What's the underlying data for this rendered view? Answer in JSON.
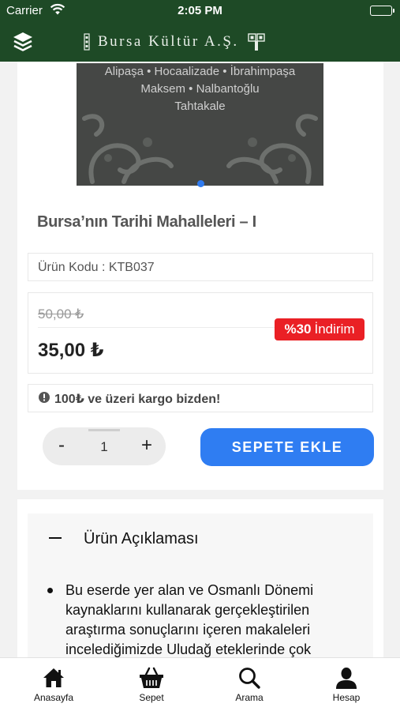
{
  "status_bar": {
    "carrier": "Carrier",
    "time": "2:05 PM"
  },
  "header": {
    "title": "Bursa Kültür A.Ş.",
    "menu_icon": "layers-icon"
  },
  "product": {
    "banner_lines": [
      "Alipaşa • Hocaalizade • İbrahimpaşa",
      "Maksem • Nalbantoğlu",
      "Tahtakale"
    ],
    "carousel": {
      "slides": 1,
      "active": 1
    },
    "title": "Bursa’nın Tarihi Mahalleleri – I",
    "code_label": "Ürün Kodu : KTB037",
    "old_price": "50,00 ₺",
    "new_price": "35,00 ₺",
    "discount_value": "%30",
    "discount_label": "İndirim",
    "shipping_note": "100₺ ve üzeri kargo bizden!",
    "quantity": "1",
    "minus_label": "-",
    "plus_label": "+",
    "add_to_cart_label": "SEPETE EKLE"
  },
  "description": {
    "toggle_symbol": "−",
    "title": "Ürün Açıklaması",
    "text": "Bu eserde yer alan ve Osmanlı Dönemi kaynaklarını kullanarak gerçekleştirilen araştırma sonuçlarını içeren makaleleri incelediğimizde Uludağ eteklerinde çok"
  },
  "tabbar": {
    "items": [
      {
        "label": "Anasayfa",
        "icon": "home-icon"
      },
      {
        "label": "Sepet",
        "icon": "basket-icon"
      },
      {
        "label": "Arama",
        "icon": "search-icon"
      },
      {
        "label": "Hesap",
        "icon": "user-icon"
      }
    ]
  },
  "colors": {
    "header_bg": "#1e4a26",
    "accent_blue": "#2f7df2",
    "discount_red": "#ea2025"
  }
}
